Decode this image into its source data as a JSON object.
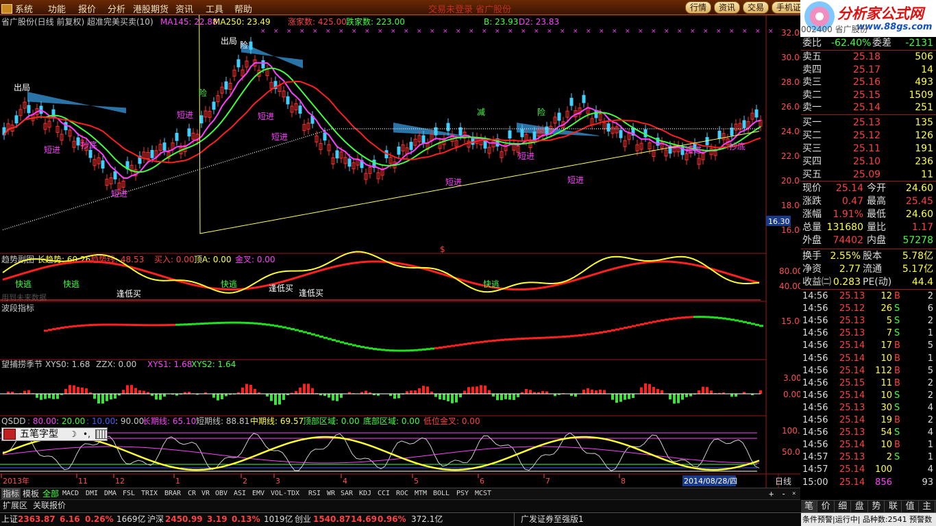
{
  "menu": [
    "系统",
    "功能",
    "报价",
    "分析",
    "港股期货",
    "资讯",
    "工具",
    "帮助"
  ],
  "app_title": "交易未登录   省广股份",
  "toolbar": [
    "行情",
    "资讯",
    "交易",
    "手机证"
  ],
  "logo": {
    "brand": "分析家公式网",
    "url": "www.88gs.com"
  },
  "main_chart": {
    "header": {
      "name": "省广股份(日线 前复权) 超准完美买卖(10)",
      "ma145": "MA145: 22.88",
      "ma250": "MA250: 23.49",
      "up_count": "涨家数: 425.00",
      "down_count": "跌家数: 223.00",
      "b": "B: 23.93",
      "d2": "D2: 23.83"
    },
    "yticks": [
      "32.00",
      "30.00",
      "28.00",
      "26.00",
      "24.00",
      "22.00",
      "20.00",
      "18.00",
      "16.00"
    ],
    "price_marker": "16.30",
    "labels": [
      {
        "t": "出局",
        "c": "#ffffff"
      },
      {
        "t": "险",
        "c": "#ffffff"
      },
      {
        "t": "出局",
        "c": "#ffffff"
      },
      {
        "t": "险",
        "c": "#40ff40"
      },
      {
        "t": "减",
        "c": "#40ff40"
      },
      {
        "t": "险",
        "c": "#40ff40"
      },
      {
        "t": "短进",
        "c": "#ff40ff"
      },
      {
        "t": "抄底",
        "c": "#ff40ff"
      },
      {
        "t": "短进",
        "c": "#ff40ff"
      },
      {
        "t": "短进",
        "c": "#ff40ff"
      },
      {
        "t": "短进",
        "c": "#ff40ff"
      },
      {
        "t": "短进",
        "c": "#ff40ff"
      },
      {
        "t": "短进",
        "c": "#ff40ff"
      },
      {
        "t": "短进",
        "c": "#ff40ff"
      },
      {
        "t": "短进",
        "c": "#ff40ff"
      },
      {
        "t": "抄底",
        "c": "#ff40ff"
      },
      {
        "t": "短进",
        "c": "#ff40ff"
      }
    ],
    "dollar": "$"
  },
  "panel1": {
    "title": "趋势副图",
    "v1": "长趋势: 60.26",
    "v2": "趋势线: 48.53",
    "v3": "买入: 0.00",
    "v4": "顶A: 0.00",
    "v5": "金叉: 0.00",
    "yticks": [
      "80.00",
      "40.00"
    ],
    "notes": [
      "快逃",
      "快逃",
      "快逃",
      "快逃",
      "逢低买",
      "逢低买",
      "逢低买"
    ],
    "ghost": "用到未来数据"
  },
  "panel2": {
    "title": "波段指标",
    "yticks": [
      "15.00"
    ]
  },
  "panel3": {
    "title": "望捕捞季节",
    "v1": "XYS0: 1.68",
    "v2": "ZZX: 0.00",
    "v3": "XYS1: 1.68",
    "v4": "XYS2: 1.64",
    "yticks": [
      "3.00",
      "0.00"
    ]
  },
  "panel4": {
    "title": "QSDD",
    "v1": ": 80.00",
    "v2": ": 20.00",
    "v3": ": 10.00",
    "v4": ": 90.00",
    "v5": "长期线: 65.10",
    "v6": "短期线: 88.81",
    "v7": "中期线: 69.57",
    "v8": "顶部区域: 0.00",
    "v9": "底部区域: 0.00",
    "v10": "低位金叉: 0.00",
    "yticks": [
      "100.0",
      "50.00"
    ]
  },
  "xaxis": {
    "labels": [
      "2013年",
      "11",
      "12",
      "1",
      "2",
      "3",
      "4",
      "5",
      "6",
      "7",
      "8"
    ],
    "date": "2014/08/28/四",
    "period": "日线"
  },
  "ime": {
    "name": "五笔字型"
  },
  "index_tabs": [
    "指标",
    "模板",
    "全部",
    "MACD",
    "DMI",
    "DMA",
    "FSL",
    "TRIX",
    "BRAR",
    "CR",
    "VR",
    "OBV",
    "ASI",
    "EMV",
    "VOL-TDX",
    "RSI",
    "WR",
    "SAR",
    "KDJ",
    "CCI",
    "ROC",
    "MTM",
    "BOLL",
    "PSY",
    "MCST"
  ],
  "bottom_tabs": [
    "扩展区",
    "关联报价"
  ],
  "quote": {
    "code_ghost": "002400 省广股份",
    "weibi": {
      "l": "委比",
      "v": "-62.40%",
      "l2": "委差",
      "v2": "-2131"
    },
    "sell": [
      {
        "l": "卖五",
        "p": "25.18",
        "v": "506"
      },
      {
        "l": "卖四",
        "p": "25.17",
        "v": "14"
      },
      {
        "l": "卖三",
        "p": "25.16",
        "v": "493"
      },
      {
        "l": "卖二",
        "p": "25.15",
        "v": "1509"
      },
      {
        "l": "卖一",
        "p": "25.14",
        "v": "251"
      }
    ],
    "buy": [
      {
        "l": "买一",
        "p": "25.13",
        "v": "135"
      },
      {
        "l": "买二",
        "p": "25.12",
        "v": "126"
      },
      {
        "l": "买三",
        "p": "25.11",
        "v": "191"
      },
      {
        "l": "买四",
        "p": "25.10",
        "v": "236"
      },
      {
        "l": "买五",
        "p": "25.09",
        "v": "11"
      }
    ],
    "stats": [
      {
        "l": "现价",
        "v": "25.14",
        "vc": "#ff4040",
        "l2": "今开",
        "v2": "24.60",
        "v2c": "#ffff40"
      },
      {
        "l": "涨跌",
        "v": "0.47",
        "vc": "#ff4040",
        "l2": "最高",
        "v2": "25.45",
        "v2c": "#ff4040"
      },
      {
        "l": "涨幅",
        "v": "1.91%",
        "vc": "#ff4040",
        "l2": "最低",
        "v2": "24.60",
        "v2c": "#ffff40"
      },
      {
        "l": "总量",
        "v": "131680",
        "vc": "#ffff40",
        "l2": "量比",
        "v2": "1.17",
        "v2c": "#ff4040"
      },
      {
        "l": "外盘",
        "v": "74402",
        "vc": "#ff4040",
        "l2": "内盘",
        "v2": "57278",
        "v2c": "#40ff40"
      }
    ],
    "stats2": [
      {
        "l": "换手",
        "v": "2.55%",
        "l2": "股本",
        "v2": "5.78亿"
      },
      {
        "l": "净资",
        "v": "2.77",
        "l2": "流通",
        "v2": "5.17亿"
      },
      {
        "l": "收益㈡",
        "v": "0.283",
        "l2": "PE(动)",
        "v2": "44.4"
      }
    ],
    "ticks": [
      {
        "t": "14:56",
        "p": "25.13",
        "v": "12",
        "d": "B",
        "n": "2"
      },
      {
        "t": "14:56",
        "p": "25.12",
        "v": "26",
        "d": "S",
        "n": "6"
      },
      {
        "t": "14:56",
        "p": "25.13",
        "v": "5",
        "d": "S",
        "n": "2"
      },
      {
        "t": "14:56",
        "p": "25.13",
        "v": "7",
        "d": "S",
        "n": "1"
      },
      {
        "t": "14:56",
        "p": "25.14",
        "v": "17",
        "d": "B",
        "n": "5"
      },
      {
        "t": "14:56",
        "p": "25.14",
        "v": "10",
        "d": "B",
        "n": "1"
      },
      {
        "t": "14:56",
        "p": "25.14",
        "v": "112",
        "d": "B",
        "n": "5"
      },
      {
        "t": "14:56",
        "p": "25.15",
        "v": "11",
        "d": "B",
        "n": "2"
      },
      {
        "t": "14:56",
        "p": "25.14",
        "v": "10",
        "d": "S",
        "n": "2"
      },
      {
        "t": "14:56",
        "p": "25.13",
        "v": "30",
        "d": "S",
        "n": "4"
      },
      {
        "t": "14:56",
        "p": "25.14",
        "v": "19",
        "d": "B",
        "n": "2"
      },
      {
        "t": "14:56",
        "p": "25.13",
        "v": "54",
        "d": "S",
        "n": "4"
      },
      {
        "t": "14:56",
        "p": "25.14",
        "v": "10",
        "d": "B",
        "n": "1"
      },
      {
        "t": "14:57",
        "p": "25.13",
        "v": "2",
        "d": "S",
        "n": "1"
      },
      {
        "t": "14:57",
        "p": "25.14",
        "v": "100",
        "d": "",
        "n": "4"
      },
      {
        "t": "15:00",
        "p": "25.14",
        "v": "856",
        "d": "",
        "n": "93"
      }
    ],
    "tabs": [
      "笔",
      "价",
      "细",
      "盘",
      "势",
      "联",
      "值",
      "主"
    ]
  },
  "status": {
    "sh_l": "上证",
    "sh_v": "2363.87",
    "sh_c": "6.16",
    "sh_p": "0.26%",
    "sh_a": "1669亿",
    "sz_l": "沪深",
    "sz_v": "2450.99",
    "sz_c": "3.19",
    "sz_p": "0.13%",
    "sz_a": "1019亿",
    "cy_l": "创业",
    "cy_v": "1540.87",
    "cy_c": "14.69",
    "cy_p": "0.96%",
    "cy_a": "372.1亿",
    "msg": "广发证券至强版1",
    "right": "条件预警|运行中| 品种数:2541 预警数"
  }
}
